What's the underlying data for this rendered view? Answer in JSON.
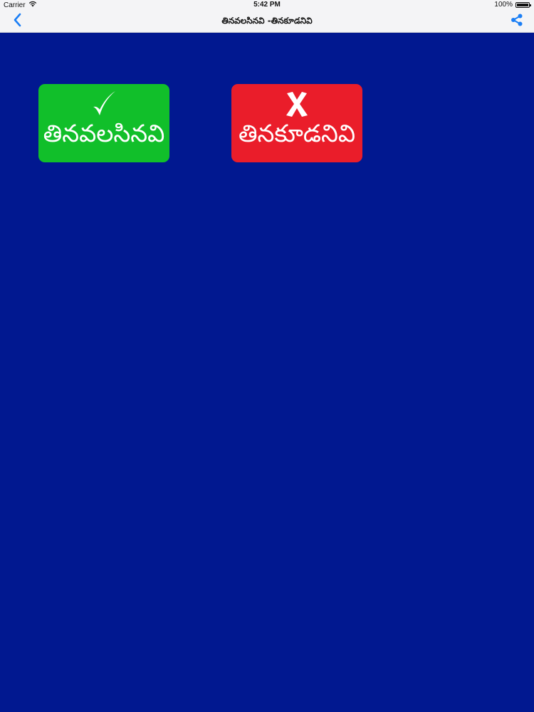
{
  "status_bar": {
    "carrier": "Carrier",
    "time": "5:42 PM",
    "battery_text": "100%",
    "battery_level": 1.0
  },
  "nav": {
    "title": "తినవలసినవి -తినకూడనివి",
    "back_icon": "chevron-left-icon",
    "share_icon": "share-icon",
    "accent_color": "#1a7ef5"
  },
  "tiles": [
    {
      "label": "తినవలసినవి",
      "icon": "checkmark-icon",
      "color": "#11bf2a"
    },
    {
      "label": "తినకూడనివి",
      "icon": "cross-icon",
      "color": "#ea1d2a"
    }
  ],
  "colors": {
    "background": "#011890",
    "bar_background": "#f4f4f6"
  }
}
